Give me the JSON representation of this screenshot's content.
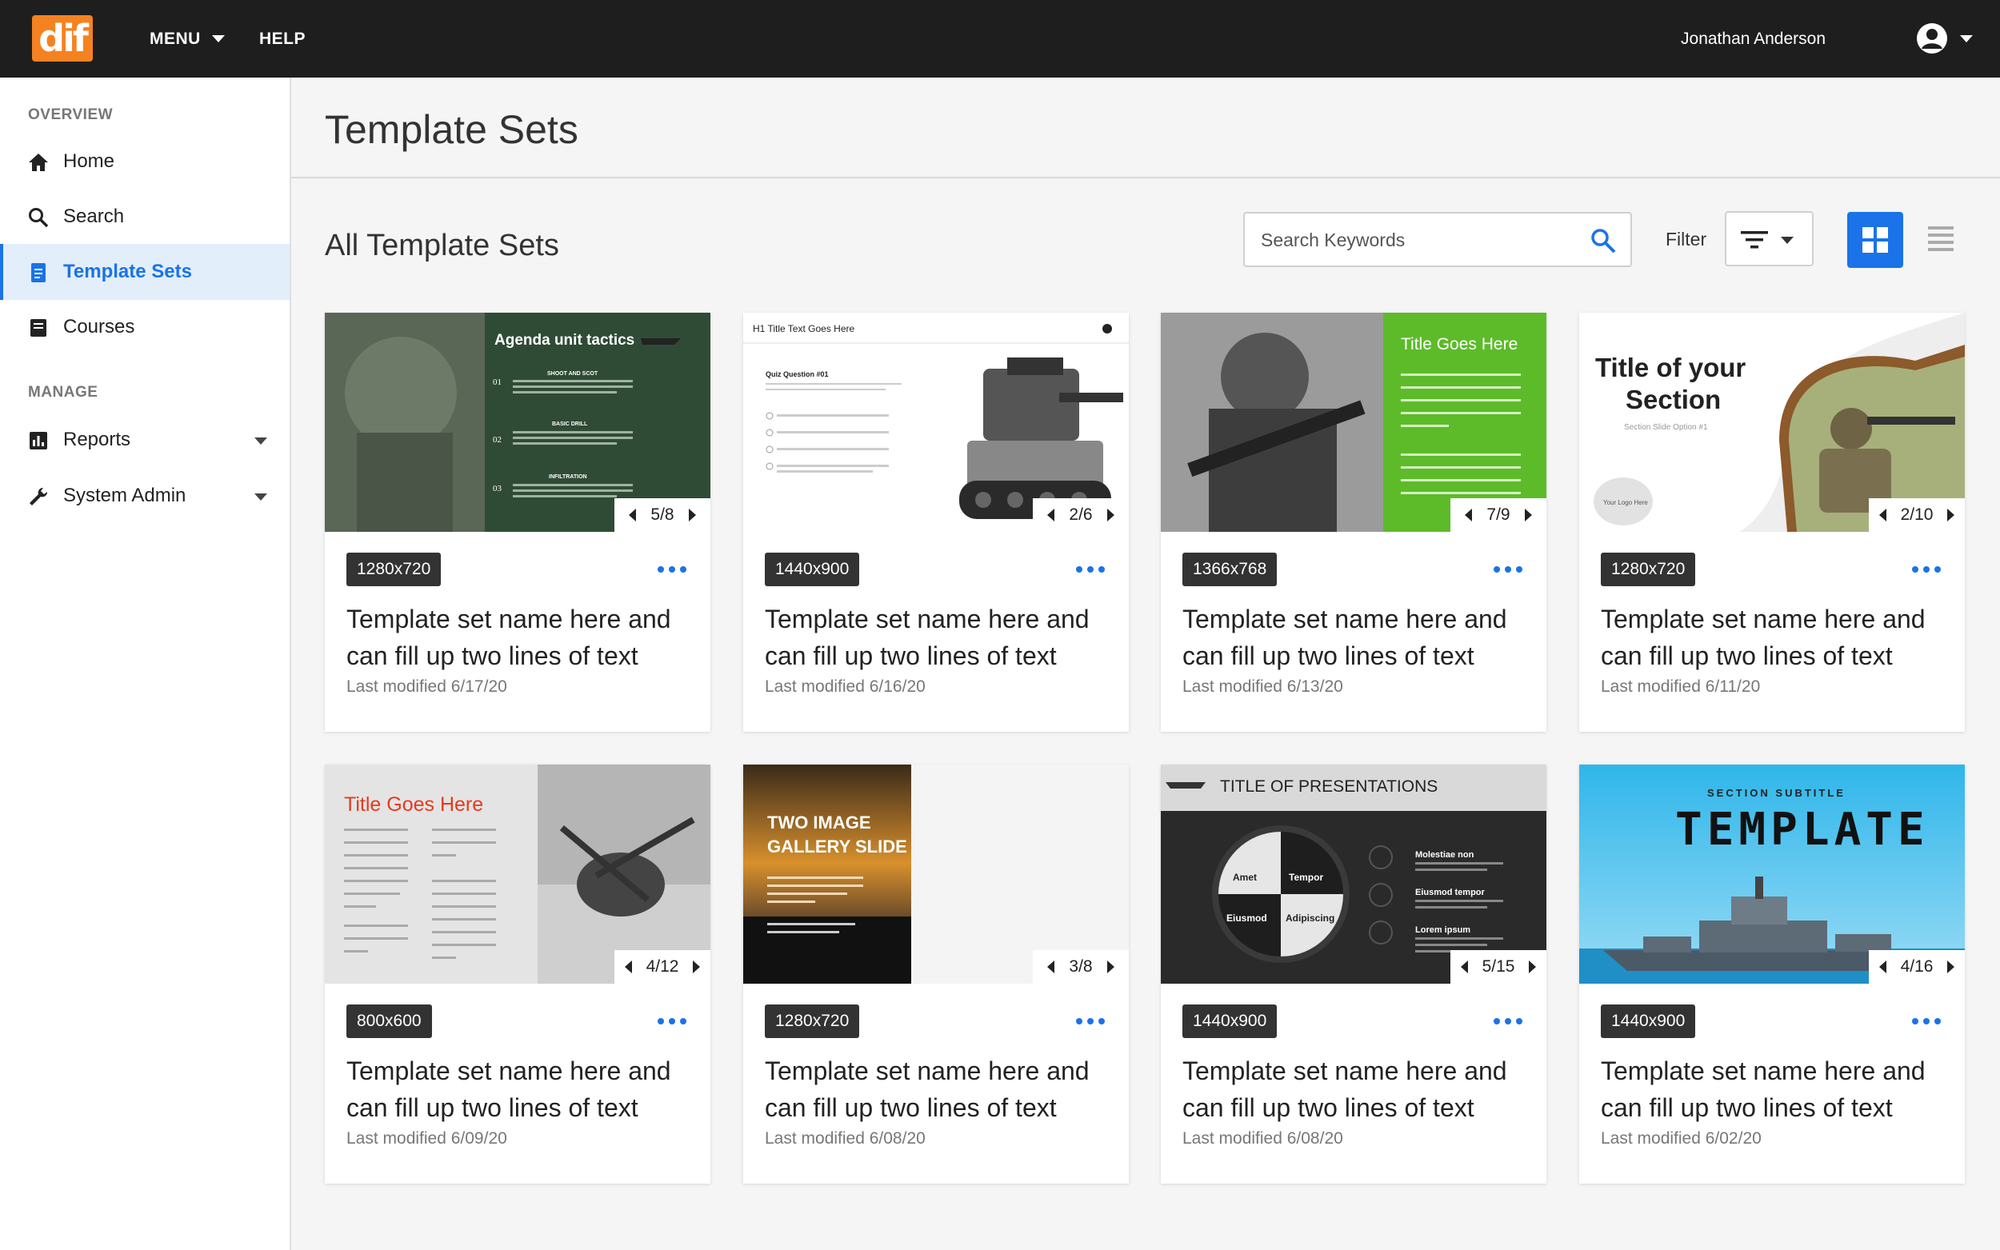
{
  "app": {
    "logo_text": "dif"
  },
  "topnav": {
    "menu_label": "MENU",
    "help_label": "HELP",
    "user_name": "Jonathan Anderson"
  },
  "sidebar": {
    "overview_label": "OVERVIEW",
    "manage_label": "MANAGE",
    "items": [
      {
        "label": "Home",
        "icon": "home-icon"
      },
      {
        "label": "Search",
        "icon": "search-icon"
      },
      {
        "label": "Template Sets",
        "icon": "document-icon",
        "active": true
      },
      {
        "label": "Courses",
        "icon": "book-icon"
      },
      {
        "label": "Reports",
        "icon": "bar-chart-icon"
      },
      {
        "label": "System Admin",
        "icon": "wrench-icon"
      }
    ]
  },
  "page": {
    "title": "Template Sets",
    "section_title": "All Template Sets"
  },
  "search": {
    "placeholder": "Search Keywords",
    "value": ""
  },
  "filter": {
    "label": "Filter"
  },
  "colors": {
    "accent": "#1a73e8",
    "topbar": "#1e1e1e",
    "logo": "#f58220"
  },
  "cards": [
    {
      "resolution": "1280x720",
      "title": "Template set name here and can fill up two lines of text",
      "modified": "Last modified 6/17/20",
      "pager": "5/8",
      "thumb": {
        "title": "Agenda unit tactics",
        "items": [
          "SHOOT AND SCOT",
          "BASIC DRILL",
          "INFILTRATION"
        ],
        "nums": [
          "01",
          "02",
          "03"
        ]
      }
    },
    {
      "resolution": "1440x900",
      "title": "Template set name here and can fill up two lines of text",
      "modified": "Last modified 6/16/20",
      "pager": "2/6",
      "thumb": {
        "title": "H1 Title Text Goes Here",
        "subtitle": "Quiz Question #01"
      }
    },
    {
      "resolution": "1366x768",
      "title": "Template set name here and can fill up two lines of text",
      "modified": "Last modified 6/13/20",
      "pager": "7/9",
      "thumb": {
        "title": "Title Goes Here"
      }
    },
    {
      "resolution": "1280x720",
      "title": "Template set name here and can fill up two lines of text",
      "modified": "Last modified 6/11/20",
      "pager": "2/10",
      "thumb": {
        "title_line1": "Title of your",
        "title_line2": "Section",
        "subtitle": "Section Slide Option #1",
        "logo": "Your Logo Here"
      }
    },
    {
      "resolution": "800x600",
      "title": "Template set name here and can fill up two lines of text",
      "modified": "Last modified 6/09/20",
      "pager": "4/12",
      "thumb": {
        "title": "Title Goes Here"
      }
    },
    {
      "resolution": "1280x720",
      "title": "Template set name here and can fill up two lines of text",
      "modified": "Last modified 6/08/20",
      "pager": "3/8",
      "thumb": {
        "title_line1": "TWO IMAGE",
        "title_line2": "GALLERY SLIDE"
      }
    },
    {
      "resolution": "1440x900",
      "title": "Template set name here and can fill up two lines of text",
      "modified": "Last modified 6/08/20",
      "pager": "5/15",
      "thumb": {
        "title": "TITLE OF PRESENTATIONS",
        "quad": [
          "Amet",
          "Tempor",
          "Eiusmod",
          "Adipiscing"
        ],
        "items": [
          "Molestiae non",
          "Eiusmod tempor",
          "Lorem ipsum"
        ]
      }
    },
    {
      "resolution": "1440x900",
      "title": "Template set name here and can fill up two lines of text",
      "modified": "Last modified 6/02/20",
      "pager": "4/16",
      "thumb": {
        "subtitle": "SECTION SUBTITLE",
        "title": "TEMPLATE"
      }
    }
  ]
}
